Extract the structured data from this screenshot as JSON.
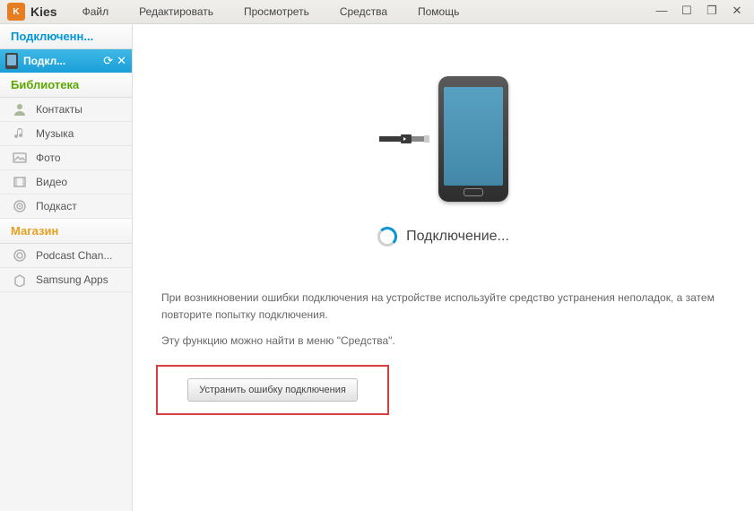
{
  "app": {
    "logo_text": "K",
    "title": "Kies"
  },
  "menu": {
    "file": "Файл",
    "edit": "Редактировать",
    "view": "Просмотреть",
    "tools": "Средства",
    "help": "Помощь"
  },
  "sidebar": {
    "connected": {
      "header": "Подключенн...",
      "device": "Подкл..."
    },
    "library": {
      "header": "Библиотека",
      "items": {
        "contacts": "Контакты",
        "music": "Музыка",
        "photo": "Фото",
        "video": "Видео",
        "podcast": "Подкаст"
      }
    },
    "store": {
      "header": "Магазин",
      "items": {
        "podcast_channel": "Podcast Chan...",
        "samsung_apps": "Samsung Apps"
      }
    }
  },
  "main": {
    "status": "Подключение...",
    "info_line1": "При возникновении ошибки подключения на устройстве используйте средство устранения неполадок, а затем повторите попытку подключения.",
    "info_line2": "Эту функцию можно найти в меню \"Средства\".",
    "fix_button": "Устранить ошибку подключения"
  }
}
